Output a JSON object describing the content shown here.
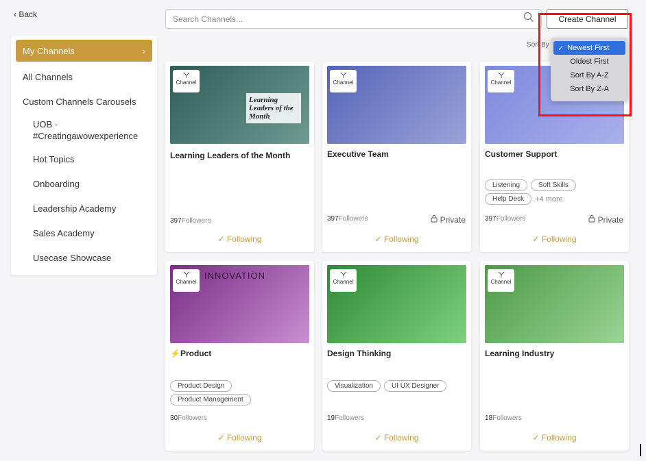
{
  "nav": {
    "back_label": "Back"
  },
  "search": {
    "placeholder": "Search Channels..."
  },
  "actions": {
    "create_label": "Create Channel"
  },
  "sort": {
    "label": "Sort By",
    "options": [
      "Newest First",
      "Oldest First",
      "Sort By A-Z",
      "Sort By Z-A"
    ],
    "selected_index": 0
  },
  "sidebar": {
    "items": [
      {
        "label": "My Channels"
      },
      {
        "label": "All Channels"
      },
      {
        "label": "Custom Channels Carousels"
      },
      {
        "label": "UOB - #Creatingawowexperience"
      },
      {
        "label": "Hot Topics"
      },
      {
        "label": "Onboarding"
      },
      {
        "label": "Leadership Academy"
      },
      {
        "label": "Sales Academy"
      },
      {
        "label": "Usecase Showcase"
      }
    ]
  },
  "cards": [
    {
      "badge": "Channel",
      "title": "Learning Leaders of the Month",
      "tags": [],
      "more": "",
      "followers_count": "397",
      "followers_label": "Followers",
      "private_label": "",
      "follow_label": "Following",
      "image_caption": "Learning Leaders of the Month",
      "img_colors": [
        "#2f5d59",
        "#6e9a91"
      ]
    },
    {
      "badge": "Channel",
      "title": "Executive Team",
      "tags": [],
      "more": "",
      "followers_count": "397",
      "followers_label": "Followers",
      "private_label": "Private",
      "follow_label": "Following",
      "image_caption": "",
      "img_colors": [
        "#5563b8",
        "#9aa4d8"
      ]
    },
    {
      "badge": "Channel",
      "title": "Customer Support",
      "tags": [
        "Listening",
        "Soft Skills",
        "Help Desk"
      ],
      "more": "+4 more",
      "followers_count": "397",
      "followers_label": "Followers",
      "private_label": "Private",
      "follow_label": "Following",
      "image_caption": "",
      "img_colors": [
        "#7d89dd",
        "#a9b1ea"
      ]
    },
    {
      "badge": "Channel",
      "title": "⚡Product",
      "tags": [
        "Product Design",
        "Product Management"
      ],
      "more": "",
      "followers_count": "30",
      "followers_label": "Followers",
      "private_label": "",
      "follow_label": "Following",
      "image_caption": "INNOVATION",
      "img_colors": [
        "#7a2d86",
        "#c98fd2"
      ]
    },
    {
      "badge": "Channel",
      "title": "Design Thinking",
      "tags": [
        "Visualization",
        "UI UX Designer"
      ],
      "more": "",
      "followers_count": "19",
      "followers_label": "Followers",
      "private_label": "",
      "follow_label": "Following",
      "image_caption": "",
      "img_colors": [
        "#2f8a35",
        "#7ed07f"
      ]
    },
    {
      "badge": "Channel",
      "title": "Learning Industry",
      "tags": [],
      "more": "",
      "followers_count": "18",
      "followers_label": "Followers",
      "private_label": "",
      "follow_label": "Following",
      "image_caption": "",
      "img_colors": [
        "#4c9a47",
        "#9ad493"
      ]
    }
  ]
}
